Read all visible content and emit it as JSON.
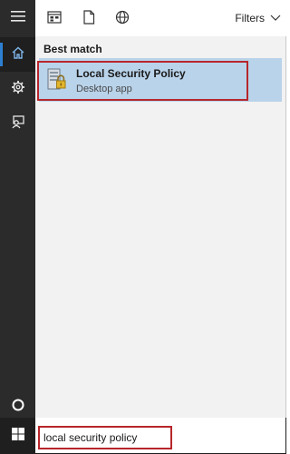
{
  "left_rail": {
    "items": [
      {
        "name": "hamburger-menu-icon",
        "label": "Menu"
      },
      {
        "name": "home-icon",
        "label": "Home"
      },
      {
        "name": "settings-icon",
        "label": "Settings"
      },
      {
        "name": "feedback-icon",
        "label": "Feedback"
      },
      {
        "name": "cortana-icon",
        "label": "Cortana"
      }
    ],
    "accent_color": "#2d7fd2"
  },
  "top_bar": {
    "scopes": [
      {
        "icon": "apps-icon"
      },
      {
        "icon": "documents-icon"
      },
      {
        "icon": "web-icon"
      }
    ],
    "filters_label": "Filters"
  },
  "results": {
    "section_title": "Best match",
    "items": [
      {
        "title": "Local Security Policy",
        "subtitle": "Desktop app",
        "icon": "security-policy-app-icon",
        "selected": true
      }
    ],
    "highlight_color": "#b7262b",
    "selected_color": "#b9d3ea"
  },
  "search": {
    "value": "local security policy",
    "placeholder": ""
  },
  "taskbar": {
    "start_icon": "windows-start-icon"
  }
}
